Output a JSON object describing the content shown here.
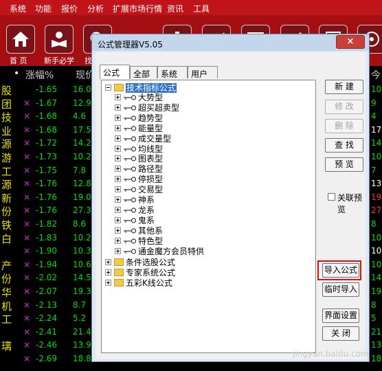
{
  "menubar": [
    "系统",
    "功能",
    "报价",
    "分析",
    "扩展市场行情",
    "资讯",
    "工具"
  ],
  "toolbar": {
    "home_label": "首 页",
    "newbie_label": "新手必学",
    "partial_label": "找"
  },
  "quote": {
    "header": {
      "change_pct": "涨幅%",
      "current": "现价",
      "right": "今"
    },
    "rows": [
      {
        "name": "股",
        "x": "",
        "pct": "-1.65",
        "val": "16.0",
        "right": "10",
        "rc": "g"
      },
      {
        "name": "团",
        "x": "×",
        "pct": "-1.67",
        "val": "12.9",
        "right": "9",
        "rc": "g"
      },
      {
        "name": "技",
        "x": "×",
        "pct": "-1.68",
        "val": "4.6",
        "right": "4",
        "rc": "g"
      },
      {
        "name": "业",
        "x": "×",
        "pct": "-1.68",
        "val": "17.5",
        "right": "17",
        "rc": "w"
      },
      {
        "name": "源",
        "x": "×",
        "pct": "-1.72",
        "val": "14.2",
        "right": "14",
        "rc": "g"
      },
      {
        "name": "游",
        "x": "×",
        "pct": "-1.73",
        "val": "10.2",
        "right": "10",
        "rc": "g"
      },
      {
        "name": "工",
        "x": "×",
        "pct": "-1.75",
        "val": "7.8",
        "right": "7",
        "rc": "g"
      },
      {
        "name": "源",
        "x": "×",
        "pct": "-1.76",
        "val": "12.8",
        "right": "13",
        "rc": "w"
      },
      {
        "name": "新",
        "x": "×",
        "pct": "-1.76",
        "val": "19.0",
        "right": "19",
        "rc": "r"
      },
      {
        "name": "份",
        "x": "×",
        "pct": "-1.76",
        "val": "27.3",
        "right": "27",
        "rc": "r"
      },
      {
        "name": "铁",
        "x": "×",
        "pct": "-1.82",
        "val": "8.6",
        "right": "8",
        "rc": "g"
      },
      {
        "name": "白",
        "x": "×",
        "pct": "-1.83",
        "val": "10.2",
        "right": "10",
        "rc": "g"
      },
      {
        "name": "",
        "x": "×",
        "pct": "-1.90",
        "val": "10.3",
        "right": "10",
        "rc": "w"
      },
      {
        "name": "产",
        "x": "×",
        "pct": "-1.94",
        "val": "10.6",
        "right": "10",
        "rc": "g"
      },
      {
        "name": "份",
        "x": "×",
        "pct": "-2.02",
        "val": "14.5",
        "right": "14",
        "rc": "g"
      },
      {
        "name": "华",
        "x": "×",
        "pct": "-2.07",
        "val": "19.3",
        "right": "19",
        "rc": "g"
      },
      {
        "name": "机",
        "x": "×",
        "pct": "-2.13",
        "val": "8.7",
        "right": "8",
        "rc": "g"
      },
      {
        "name": "工",
        "x": "×",
        "pct": "-2.24",
        "val": "5.2",
        "right": "5",
        "rc": "g"
      },
      {
        "name": "",
        "x": "×",
        "pct": "-2.41",
        "val": "21.4",
        "right": "21",
        "rc": "g"
      },
      {
        "name": "璃",
        "x": "×",
        "pct": "-2.46",
        "val": "13.9",
        "right": "13",
        "rc": "g"
      },
      {
        "name": "",
        "x": "×",
        "pct": "-2.69",
        "val": "18.8",
        "right": "18",
        "rc": "g"
      }
    ]
  },
  "dialog": {
    "title": "公式管理器V5.05",
    "close": "×",
    "tabs": [
      "公式组",
      "全部",
      "系统",
      "用户"
    ],
    "tree": {
      "root": "技术指标公式",
      "children": [
        "大势型",
        "超买超卖型",
        "趋势型",
        "能量型",
        "成交量型",
        "均线型",
        "图表型",
        "路径型",
        "停损型",
        "交易型",
        "神系",
        "龙系",
        "鬼系",
        "其他系",
        "特色型",
        "通金魔方会员特供"
      ],
      "others": [
        "条件选股公式",
        "专家系统公式",
        "五彩K线公式"
      ]
    },
    "buttons": {
      "new": "新 建",
      "modify": "修 改",
      "delete": "删 除",
      "find": "查 找",
      "preview": "预 览",
      "import": "导入公式",
      "temp_import": "临时导入",
      "ui_settings": "界面设置",
      "close": "关 闭"
    },
    "linked_preview": "关联预览"
  },
  "watermark": "jingyan.baidu.com",
  "colors": {
    "menu_red": "#c0141a",
    "toolbar_red": "#a40f14",
    "highlight": "#e01010",
    "selection": "#3170c8"
  }
}
